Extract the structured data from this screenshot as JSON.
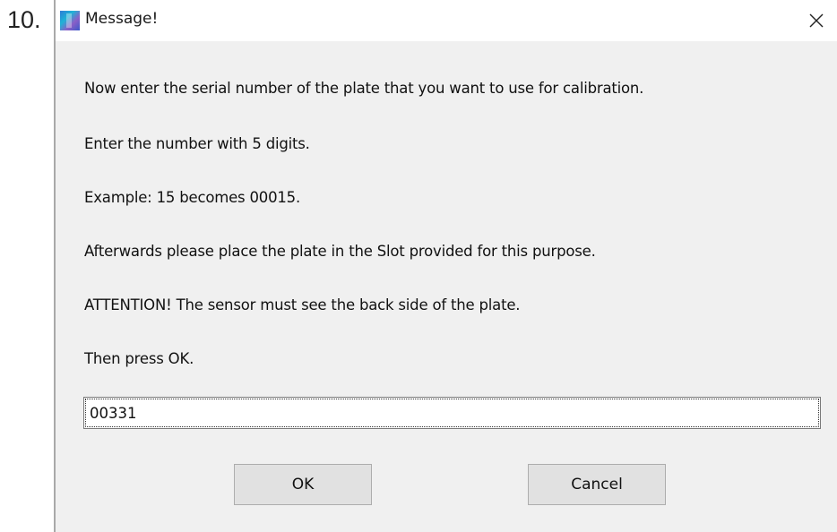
{
  "list_number": "10.",
  "window": {
    "title": "Message!",
    "icon": "app-icon",
    "close_glyph": "×"
  },
  "message_lines": [
    "Now enter the serial number of the plate that you want to use for calibration.",
    "Enter the number with 5 digits.",
    "Example: 15 becomes 00015.",
    "Afterwards please place the plate in the Slot provided for this purpose.",
    "ATTENTION! The sensor must see the back side of the plate.",
    "Then press OK."
  ],
  "serial_input": {
    "value": "00331"
  },
  "buttons": {
    "ok_label": "OK",
    "cancel_label": "Cancel"
  },
  "colors": {
    "dialog_background": "#f0f0f0",
    "titlebar_background": "#ffffff",
    "button_background": "#e1e1e1"
  }
}
